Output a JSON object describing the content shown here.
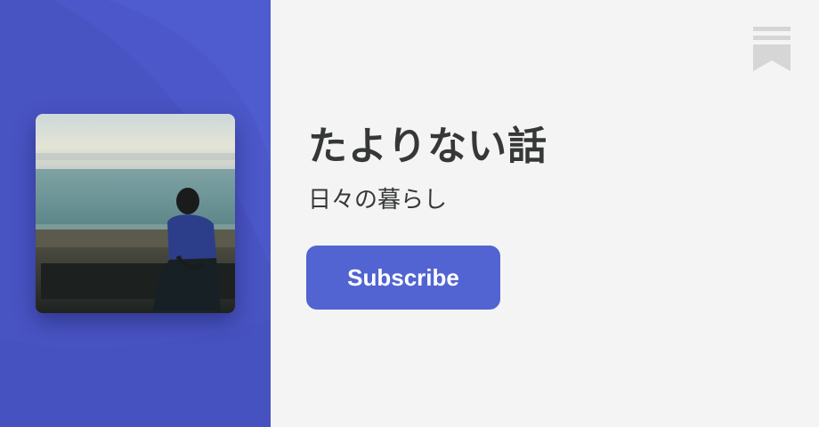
{
  "publication": {
    "title": "たよりない話",
    "tagline": "日々の暮らし"
  },
  "actions": {
    "subscribe_label": "Subscribe"
  },
  "cover_image": {
    "subject": "person sitting on bench by the sea at dusk"
  },
  "brand": {
    "icon": "substack-bookmark-icon"
  },
  "colors": {
    "accent": "#5264d1",
    "left_panel": "#4f5ccf",
    "background": "#f4f4f4",
    "text": "#363737",
    "icon": "#d6d6d6"
  }
}
